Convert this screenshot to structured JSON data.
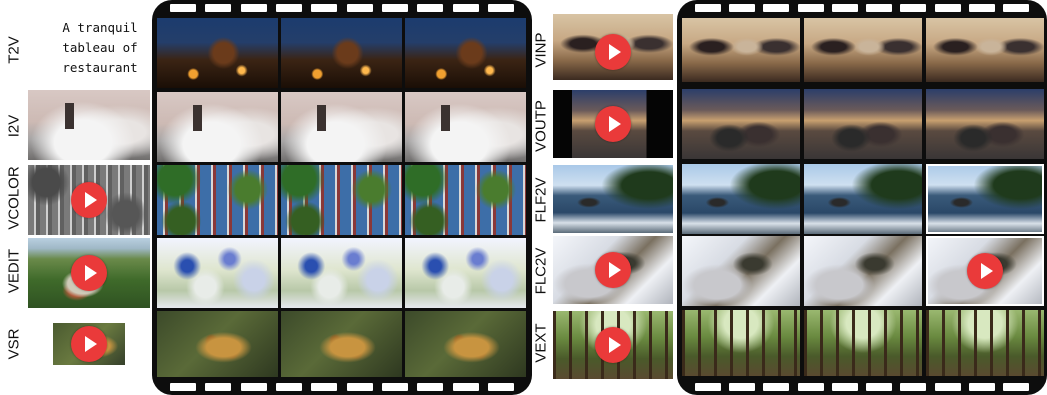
{
  "left_labels": [
    "T2V",
    "I2V",
    "VCOLOR",
    "VEDIT",
    "VSR"
  ],
  "right_labels": [
    "VINP",
    "VOUTP",
    "FLF2V",
    "FLC2V",
    "VEXT"
  ],
  "t2v_prompt": "A tranquil tableau of restaurant",
  "colors": {
    "film": "#0d0d0d",
    "play_button": "#ea3a3a"
  },
  "icons": {
    "play": "play-icon"
  }
}
